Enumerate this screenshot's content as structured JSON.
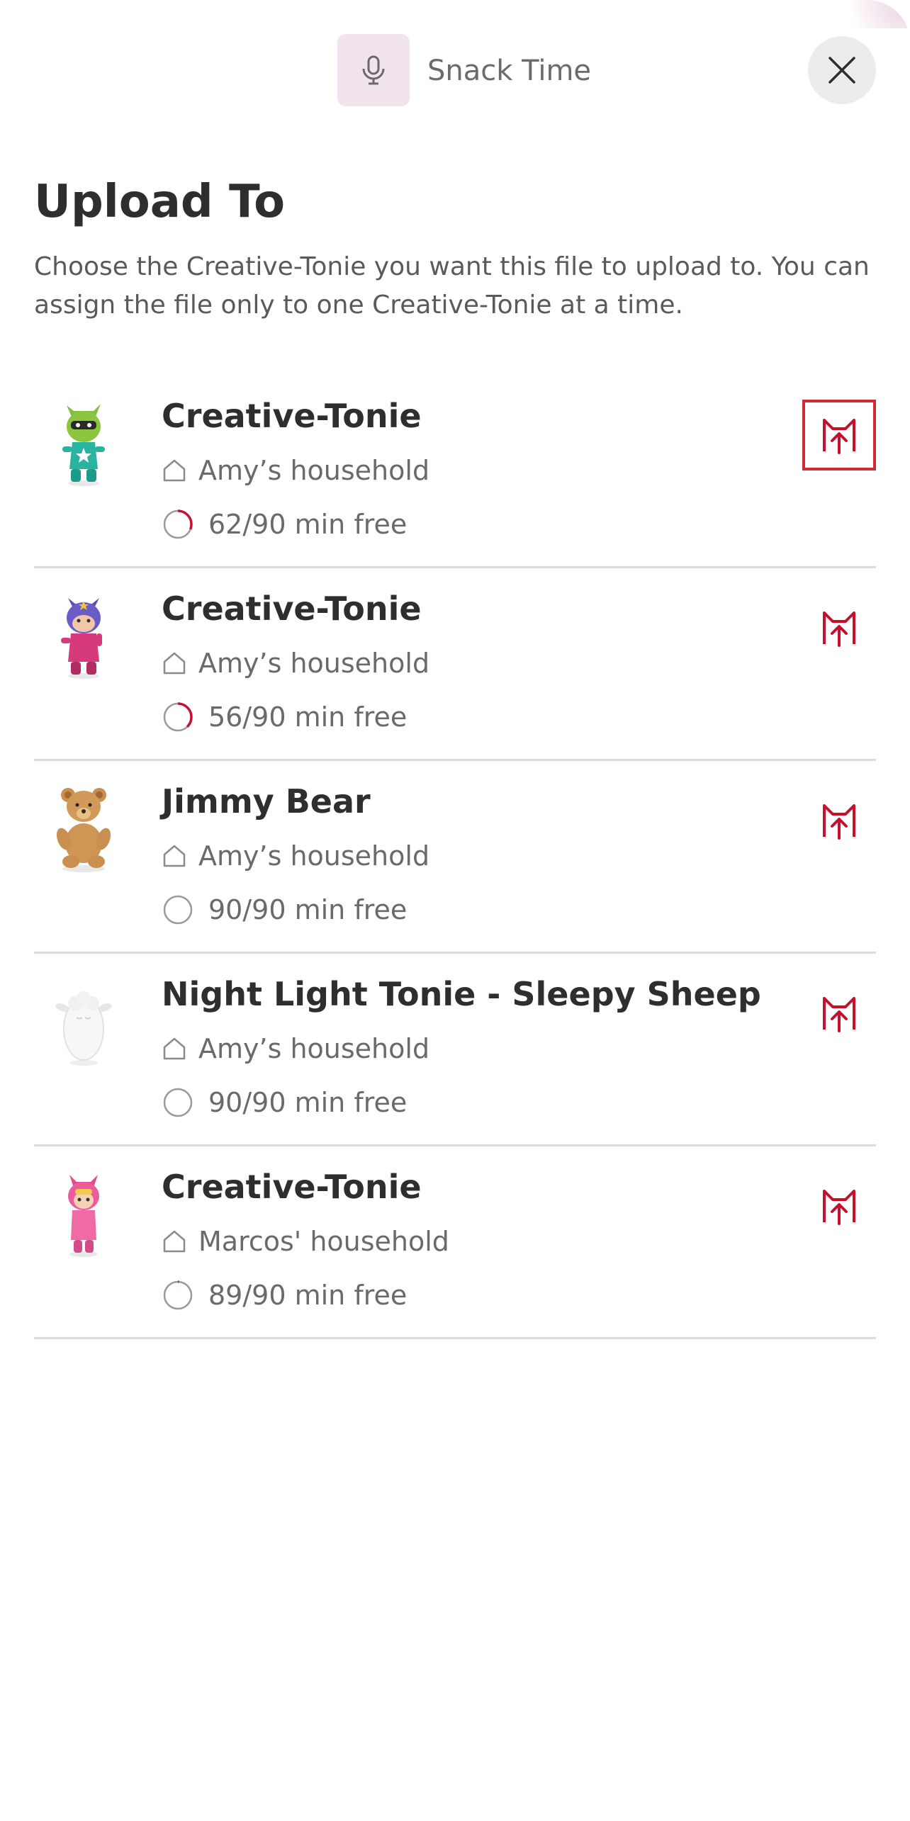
{
  "header": {
    "file_name": "Snack Time",
    "mic_icon": "microphone-icon",
    "close_icon": "close-icon"
  },
  "title": "Upload To",
  "description": "Choose the Creative-Tonie you want this file to upload to. You can assign the file only to one Creative-Tonie at a time.",
  "colors": {
    "accent": "#c8102e",
    "tile_bg": "#f2e4ee",
    "divider": "#dcdcdc"
  },
  "tonies": [
    {
      "name": "Creative-Tonie",
      "household": "Amy’s household",
      "free": "62/90 min free",
      "used_fraction": 0.31,
      "figure": "green-hero",
      "selected": true
    },
    {
      "name": "Creative-Tonie",
      "household": "Amy’s household",
      "free": "56/90 min free",
      "used_fraction": 0.378,
      "figure": "purple-hero",
      "selected": false
    },
    {
      "name": "Jimmy Bear",
      "household": "Amy’s household",
      "free": "90/90 min free",
      "used_fraction": 0,
      "figure": "teddy-bear",
      "selected": false
    },
    {
      "name": "Night Light Tonie - Sleepy Sheep",
      "household": "Amy’s household",
      "free": "90/90 min free",
      "used_fraction": 0,
      "figure": "sheep",
      "selected": false
    },
    {
      "name": "Creative-Tonie",
      "household": "Marcos' household",
      "free": "89/90 min free",
      "used_fraction": 0.011,
      "figure": "pink-cat",
      "selected": false
    }
  ]
}
